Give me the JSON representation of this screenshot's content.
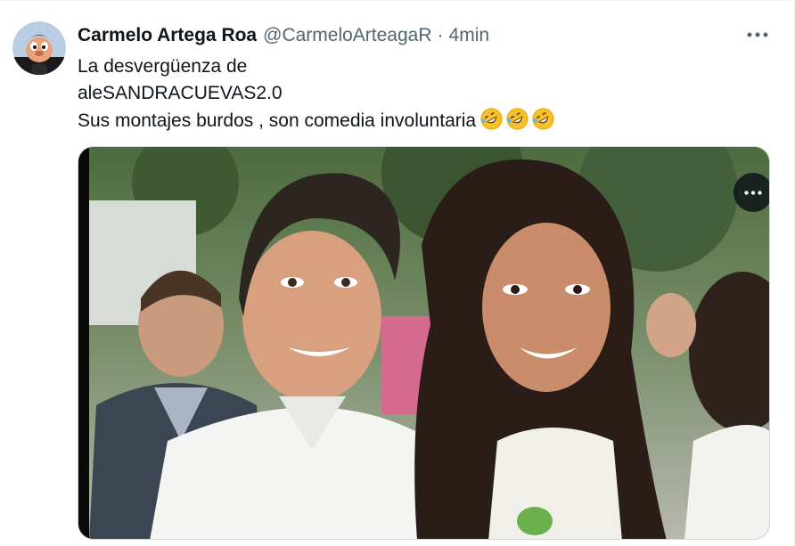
{
  "tweet": {
    "display_name": "Carmelo Artega Roa",
    "handle": "@CarmeloArteagaR",
    "separator": "·",
    "time": "4min",
    "text_lines": [
      "La desvergüenza de",
      "aleSANDRACUEVAS2.0",
      "Sus montajes burdos , son comedia involuntaria"
    ],
    "emojis": [
      "rolling-on-floor-laughing",
      "rolling-on-floor-laughing",
      "rolling-on-floor-laughing"
    ]
  },
  "icons": {
    "more": "more-horizontal-icon",
    "avatar": "cartoon-character-avatar"
  },
  "colors": {
    "name": "#0f1419",
    "secondary": "#536471",
    "border": "#cfd9de",
    "emoji": "#f7c12e"
  }
}
